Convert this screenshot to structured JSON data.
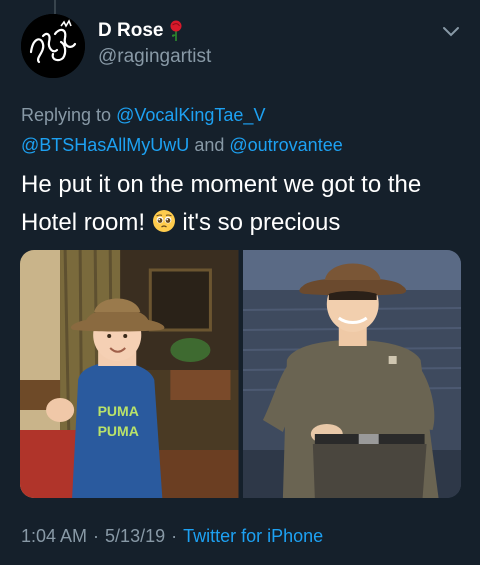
{
  "tweet": {
    "author_name": "D Rose",
    "handle": "@ragingartist",
    "reply": {
      "prefix": "Replying to",
      "mention1": "@VocalKingTae_V",
      "mention2": "@BTSHasAllMyUwU",
      "conjunction": "and",
      "mention3": "@outrovantee"
    },
    "text_line1": "He put it on the moment we got to the",
    "text_line2_a": "Hotel room!",
    "text_line2_b": "it's so precious",
    "emoji": "pleading-face-icon",
    "shirt_text_1": "PUMA",
    "shirt_text_2": "PUMA"
  },
  "meta": {
    "time": "1:04 AM",
    "date": "5/13/19",
    "separator": "·",
    "source": "Twitter for iPhone"
  },
  "colors": {
    "background": "#15202b",
    "primary_text": "#ffffff",
    "secondary_text": "#8899a6",
    "link": "#1da1f2"
  }
}
